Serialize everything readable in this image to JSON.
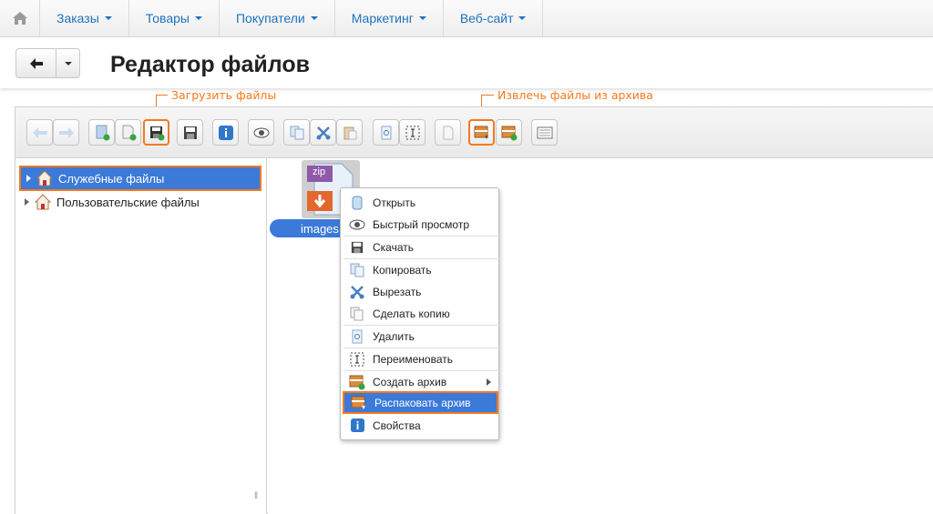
{
  "nav": {
    "items": [
      {
        "label": "Заказы"
      },
      {
        "label": "Товары"
      },
      {
        "label": "Покупатели"
      },
      {
        "label": "Маркетинг"
      },
      {
        "label": "Веб-сайт"
      }
    ]
  },
  "header": {
    "title": "Редактор файлов"
  },
  "callouts": {
    "upload": "Загрузить файлы",
    "extract": "Извлечь файлы из архива"
  },
  "tree": {
    "items": [
      {
        "label": "Служебные файлы"
      },
      {
        "label": "Пользовательские файлы"
      }
    ]
  },
  "files": {
    "items": [
      {
        "name": "images",
        "type": "zip",
        "badge": "zip"
      }
    ]
  },
  "context_menu": {
    "items": [
      {
        "label": "Открыть",
        "icon": "open-icon"
      },
      {
        "label": "Быстрый просмотр",
        "icon": "eye-icon"
      },
      {
        "label": "Скачать",
        "icon": "floppy-icon"
      },
      {
        "label": "Копировать",
        "icon": "copy-icon"
      },
      {
        "label": "Вырезать",
        "icon": "scissors-icon"
      },
      {
        "label": "Сделать копию",
        "icon": "duplicate-icon"
      },
      {
        "label": "Удалить",
        "icon": "trash-icon"
      },
      {
        "label": "Переименовать",
        "icon": "rename-icon"
      },
      {
        "label": "Создать архив",
        "icon": "archive-create-icon"
      },
      {
        "label": "Распаковать архив",
        "icon": "archive-extract-icon"
      },
      {
        "label": "Свойства",
        "icon": "info-icon"
      }
    ]
  },
  "colors": {
    "accent": "#1e73be",
    "selection": "#3b7ad9",
    "highlight": "#f47920"
  }
}
